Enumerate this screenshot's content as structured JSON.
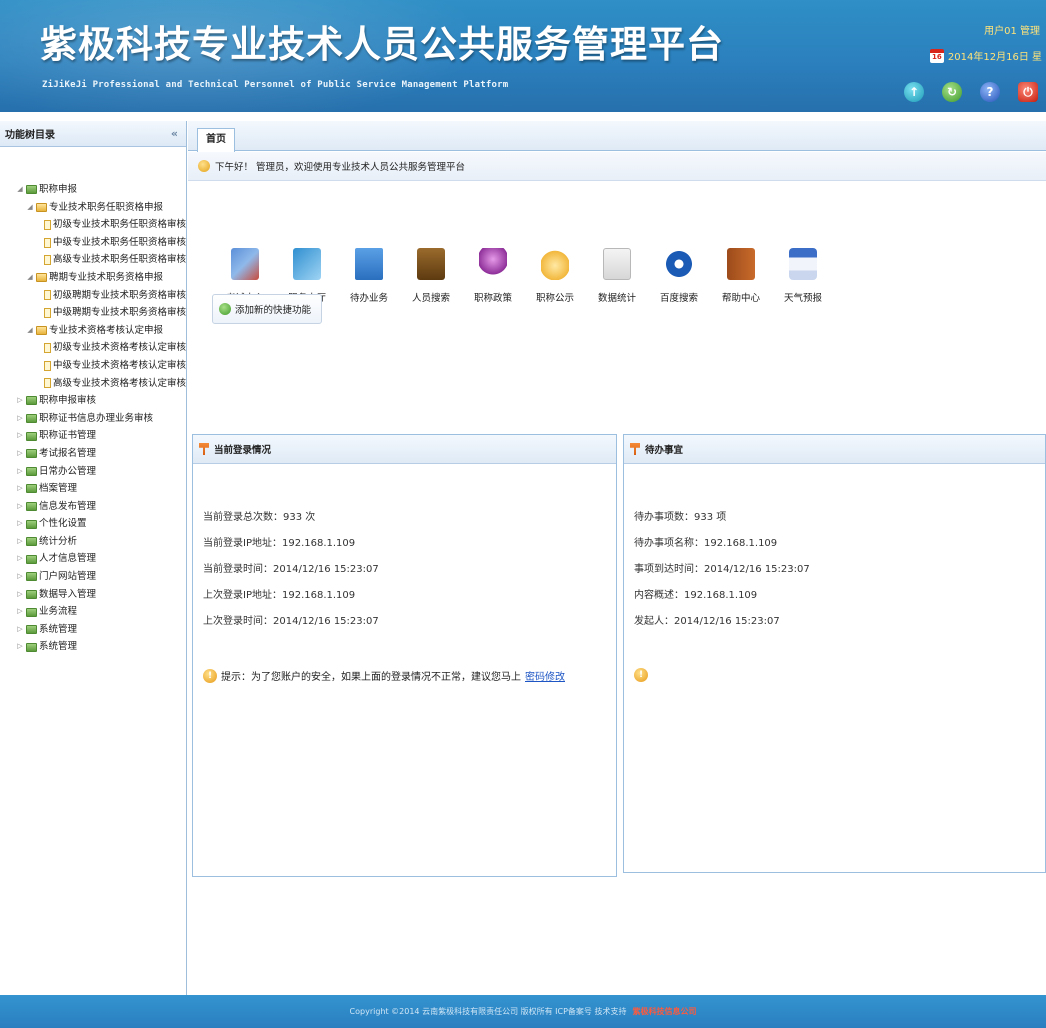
{
  "header": {
    "title": "紫极科技专业技术人员公共服务管理平台",
    "subtitle": "ZiJiKeJi Professional and Technical Personnel of Public Service Management Platform",
    "user_text": "用户01 管理",
    "date_text": "2014年12月16日 星",
    "calendar_day": "16"
  },
  "sidebar": {
    "title": "功能树目录",
    "collapse_symbol": "«",
    "tree": [
      {
        "label": "职称申报",
        "level": 0
      },
      {
        "label": "专业技术职务任职资格申报",
        "level": 1
      },
      {
        "label": "初级专业技术职务任职资格审核",
        "level": 2
      },
      {
        "label": "中级专业技术职务任职资格审核",
        "level": 2
      },
      {
        "label": "高级专业技术职务任职资格审核",
        "level": 2
      },
      {
        "label": "聘期专业技术职务资格申报",
        "level": 1
      },
      {
        "label": "初级聘期专业技术职务资格审核",
        "level": 2
      },
      {
        "label": "中级聘期专业技术职务资格审核",
        "level": 2
      },
      {
        "label": "专业技术资格考核认定申报",
        "level": 1
      },
      {
        "label": "初级专业技术资格考核认定审核",
        "level": 2
      },
      {
        "label": "中级专业技术资格考核认定审核",
        "level": 2
      },
      {
        "label": "高级专业技术资格考核认定审核",
        "level": 2
      },
      {
        "label": "职称申报审核",
        "level": 0
      },
      {
        "label": "职称证书信息办理业务审核",
        "level": 0
      },
      {
        "label": "职称证书管理",
        "level": 0
      },
      {
        "label": "考试报名管理",
        "level": 0
      },
      {
        "label": "日常办公管理",
        "level": 0
      },
      {
        "label": "档案管理",
        "level": 0
      },
      {
        "label": "信息发布管理",
        "level": 0
      },
      {
        "label": "个性化设置",
        "level": 0
      },
      {
        "label": "统计分析",
        "level": 0
      },
      {
        "label": "人才信息管理",
        "level": 0
      },
      {
        "label": "门户网站管理",
        "level": 0
      },
      {
        "label": "数据导入管理",
        "level": 0
      },
      {
        "label": "业务流程",
        "level": 0
      },
      {
        "label": "系统管理",
        "level": 0
      },
      {
        "label": "系统管理",
        "level": 0
      }
    ]
  },
  "main": {
    "tab_label": "首页",
    "welcome": "下午好！ 管理员，欢迎使用专业技术人员公共服务管理平台",
    "quick_icons": [
      {
        "label": "考试中心"
      },
      {
        "label": "服务大厅"
      },
      {
        "label": "待办业务"
      },
      {
        "label": "人员搜索"
      },
      {
        "label": "职称政策"
      },
      {
        "label": "职称公示"
      },
      {
        "label": "数据统计"
      },
      {
        "label": "百度搜索"
      },
      {
        "label": "帮助中心"
      },
      {
        "label": "天气预报"
      }
    ],
    "add_button": "添加新的快捷功能",
    "login_panel": {
      "title": "当前登录情况",
      "rows": [
        "当前登录总次数：933 次",
        "当前登录IP地址：192.168.1.109",
        "当前登录时间：2014/12/16 15:23:07",
        "上次登录IP地址：192.168.1.109",
        "上次登录时间：2014/12/16 15:23:07"
      ],
      "tip": "提示：为了您账户的安全，如果上面的登录情况不正常，建议您马上",
      "tip_link": "密码修改"
    },
    "todo_panel": {
      "title": "待办事宜",
      "rows": [
        "待办事项数：933 项",
        "待办事项名称：192.168.1.109",
        "事项到达时间：2014/12/16 15:23:07",
        "内容概述：192.168.1.109",
        "发起人：2014/12/16 15:23:07"
      ]
    }
  },
  "footer": {
    "text": "Copyright ©2014 云南紫极科技有限责任公司 版权所有 ICP备案号 技术支持",
    "mark": "紫极科技信息公司"
  }
}
